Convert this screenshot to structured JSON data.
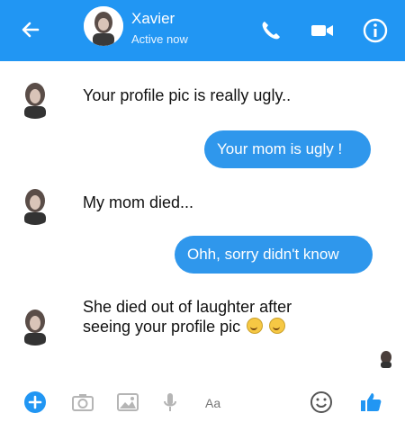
{
  "header": {
    "name": "Xavier",
    "status": "Active now",
    "icons": {
      "back": "arrow-left-icon",
      "call": "phone-icon",
      "video": "video-camera-icon",
      "info": "info-icon"
    }
  },
  "messages": [
    {
      "from": "contact",
      "text": "Your profile pic is really ugly.."
    },
    {
      "from": "me",
      "text": "Your mom is ugly !"
    },
    {
      "from": "contact",
      "text": "My mom died..."
    },
    {
      "from": "me",
      "text": "Ohh, sorry didn't know"
    },
    {
      "from": "contact",
      "line1": "She died out of laughter after",
      "line2": "seeing your profile pic"
    }
  ],
  "composer": {
    "placeholder": "Aa",
    "icons": [
      "plus-icon",
      "camera-icon",
      "image-icon",
      "microphone-icon",
      "emoji-icon",
      "thumbs-up-icon"
    ]
  },
  "colors": {
    "brand": "#2196f3",
    "bubble": "#2f97ec"
  }
}
